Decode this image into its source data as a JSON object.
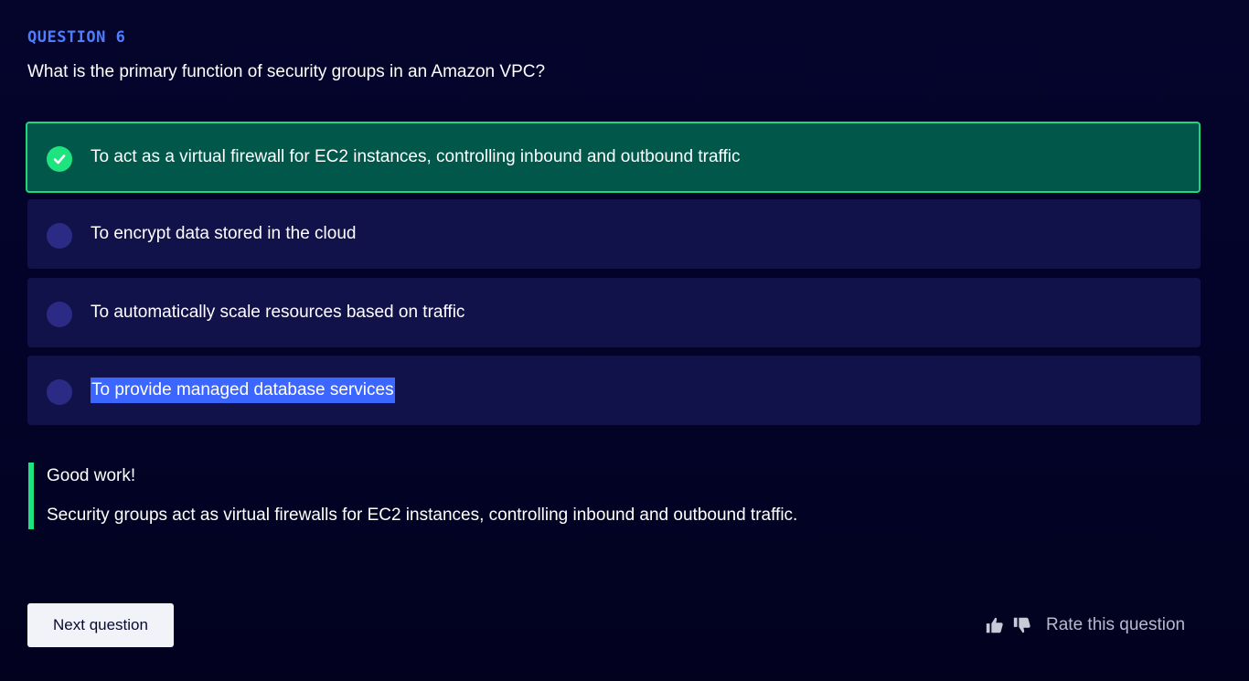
{
  "question": {
    "number_label": "QUESTION 6",
    "text": "What is the primary function of security groups in an Amazon VPC?"
  },
  "options": [
    {
      "label": "To act as a virtual firewall for EC2 instances, controlling inbound and outbound traffic",
      "state": "correct"
    },
    {
      "label": "To encrypt data stored in the cloud",
      "state": "unselected"
    },
    {
      "label": "To automatically scale resources based on traffic",
      "state": "unselected"
    },
    {
      "label": "To provide managed database services",
      "state": "unselected"
    }
  ],
  "feedback": {
    "title": "Good work!",
    "explanation": "Security groups act as virtual firewalls for EC2 instances, controlling inbound and outbound traffic."
  },
  "actions": {
    "next_label": "Next question",
    "rate_label": "Rate this question",
    "thumbs_up_icon": "thumbs-up-icon",
    "thumbs_down_icon": "thumbs-down-icon"
  },
  "colors": {
    "background": "#03032a",
    "accent_blue": "#4f7dff",
    "correct_green": "#1ee47f",
    "correct_bg": "#00574a",
    "option_bg": "#12124a",
    "text_selection": "#3b66ff"
  }
}
